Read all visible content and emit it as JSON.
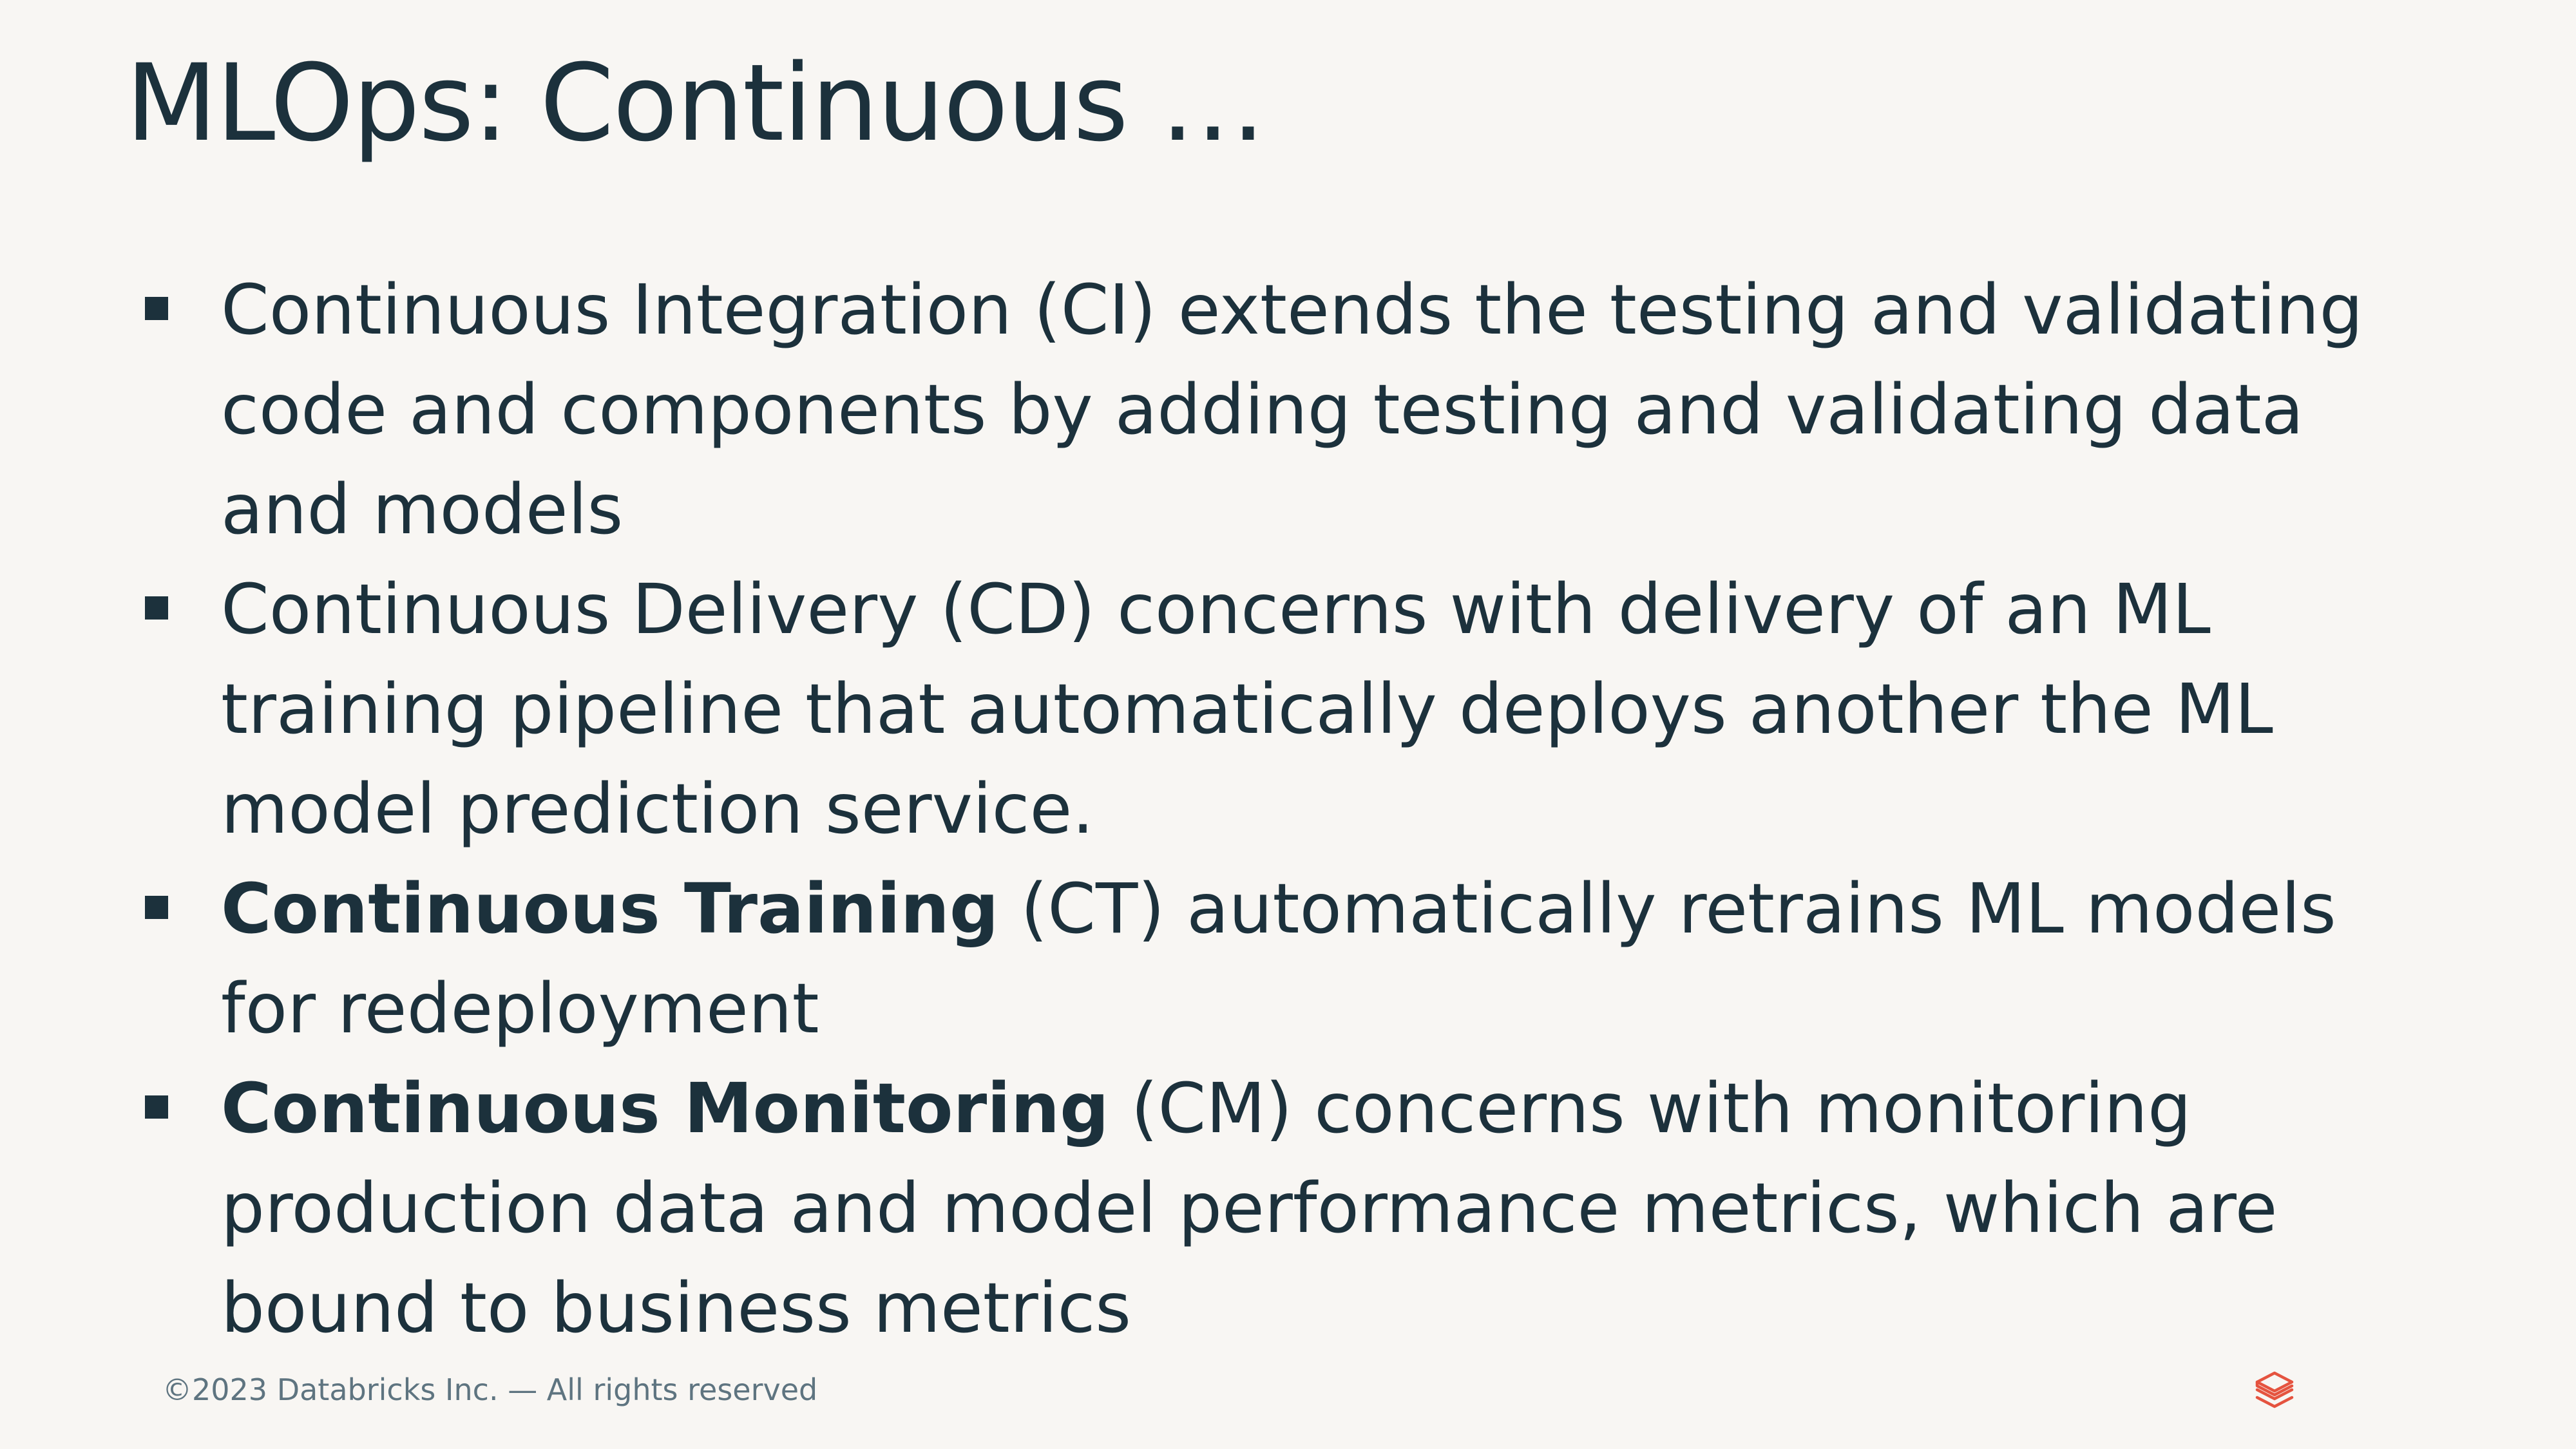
{
  "slide": {
    "title": "MLOps: Continuous …",
    "bullets": [
      {
        "bold": "",
        "text": "Continuous Integration (CI) extends the testing and validating code and components by adding testing and validating data and models"
      },
      {
        "bold": "",
        "text": "Continuous Delivery (CD) concerns with delivery of an ML training pipeline that automatically deploys another the ML model prediction service."
      },
      {
        "bold": "Continuous Training",
        "text": " (CT) automatically retrains ML models for redeployment"
      },
      {
        "bold": "Continuous Monitoring",
        "text": " (CM) concerns with monitoring production data and model performance metrics, which are bound to business metrics"
      }
    ]
  },
  "footer": {
    "copyright": "©2023 Databricks Inc. — All rights reserved",
    "logo_icon": "databricks-logo-icon"
  },
  "colors": {
    "background": "#F8F6F3",
    "text": "#1C313C",
    "footer_text": "#5E7480",
    "logo": "#E5533F"
  }
}
